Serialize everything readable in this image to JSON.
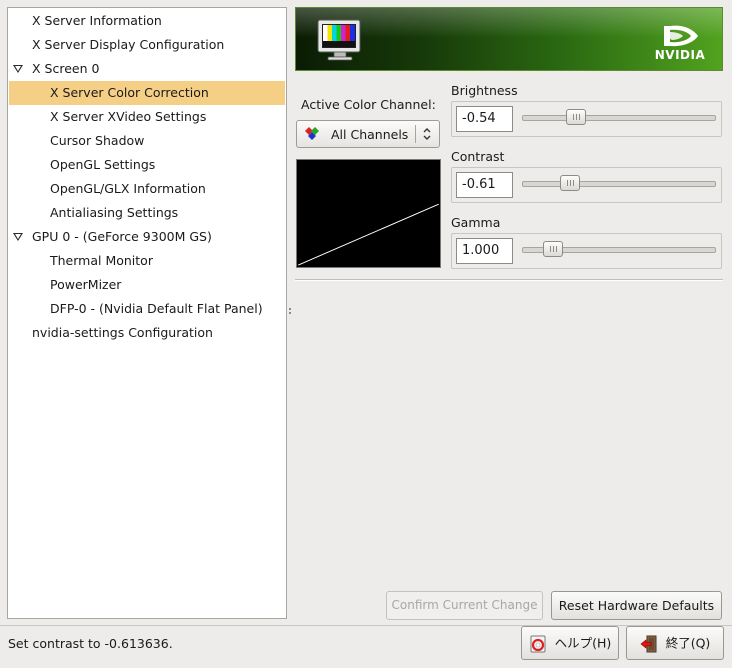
{
  "tree": {
    "items": [
      {
        "label": "X Server Information"
      },
      {
        "label": "X Server Display Configuration"
      },
      {
        "label": "X Screen 0"
      },
      {
        "label": "X Server Color Correction"
      },
      {
        "label": "X Server XVideo Settings"
      },
      {
        "label": "Cursor Shadow"
      },
      {
        "label": "OpenGL Settings"
      },
      {
        "label": "OpenGL/GLX Information"
      },
      {
        "label": "Antialiasing Settings"
      },
      {
        "label": "GPU 0 - (GeForce 9300M GS)"
      },
      {
        "label": "Thermal Monitor"
      },
      {
        "label": "PowerMizer"
      },
      {
        "label": "DFP-0 - (Nvidia Default Flat Panel)"
      },
      {
        "label": "nvidia-settings Configuration"
      }
    ],
    "selected_index": 3
  },
  "banner": {
    "logo_text": "NVIDIA",
    "icon": "monitor-color-bars-icon"
  },
  "color": {
    "channel_label": "Active Color Channel:",
    "channel_value": "All Channels",
    "brightness": {
      "label": "Brightness",
      "value": "-0.54",
      "level": 0.25
    },
    "contrast": {
      "label": "Contrast",
      "value": "-0.61",
      "level": 0.22
    },
    "gamma": {
      "label": "Gamma",
      "value": "1.000",
      "level": 0.12
    }
  },
  "buttons": {
    "confirm": "Confirm Current Change",
    "reset": "Reset Hardware Defaults",
    "help": "ヘルプ(H)",
    "quit": "終了(Q)"
  },
  "status": {
    "text": "Set contrast to -0.613636."
  },
  "colors": {
    "selection": "#f6cf86",
    "banner_green": "#52a21f",
    "window_bg": "#edeceb"
  }
}
